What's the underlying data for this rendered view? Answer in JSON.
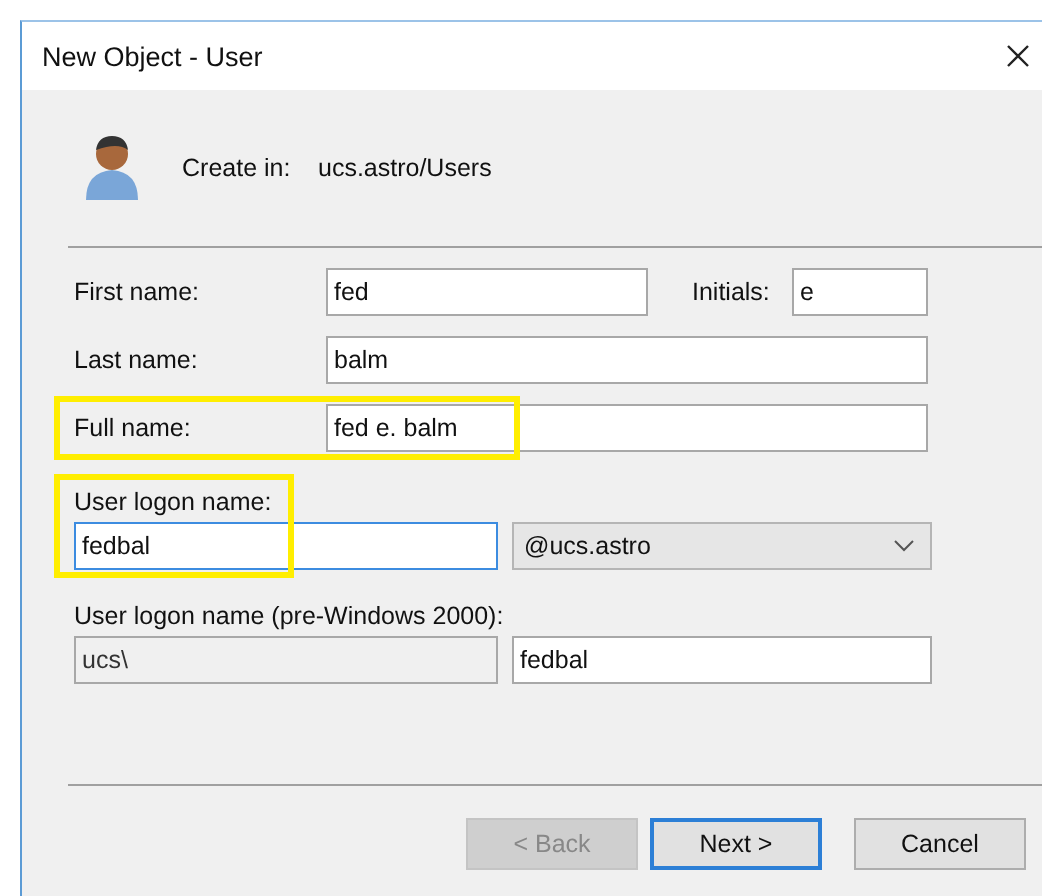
{
  "window": {
    "title": "New Object - User"
  },
  "create_in": {
    "label": "Create in:",
    "path": "ucs.astro/Users"
  },
  "first_name": {
    "label": "First name:",
    "value": "fed"
  },
  "initials": {
    "label": "Initials:",
    "value": "e"
  },
  "last_name": {
    "label": "Last name:",
    "value": "balm"
  },
  "full_name": {
    "label": "Full name:",
    "value": "fed e. balm",
    "highlighted": true
  },
  "logon": {
    "label": "User logon name:",
    "value": "fedbal",
    "focused": true,
    "highlighted": true,
    "domain": "@ucs.astro"
  },
  "pre2000": {
    "label": "User logon name (pre-Windows 2000):",
    "domain": "ucs\\",
    "domain_disabled": true,
    "value": "fedbal"
  },
  "buttons": [
    {
      "label": "< Back",
      "disabled": true,
      "default": false
    },
    {
      "label": "Next >",
      "disabled": false,
      "default": true
    },
    {
      "label": "Cancel",
      "disabled": false,
      "default": false
    }
  ]
}
